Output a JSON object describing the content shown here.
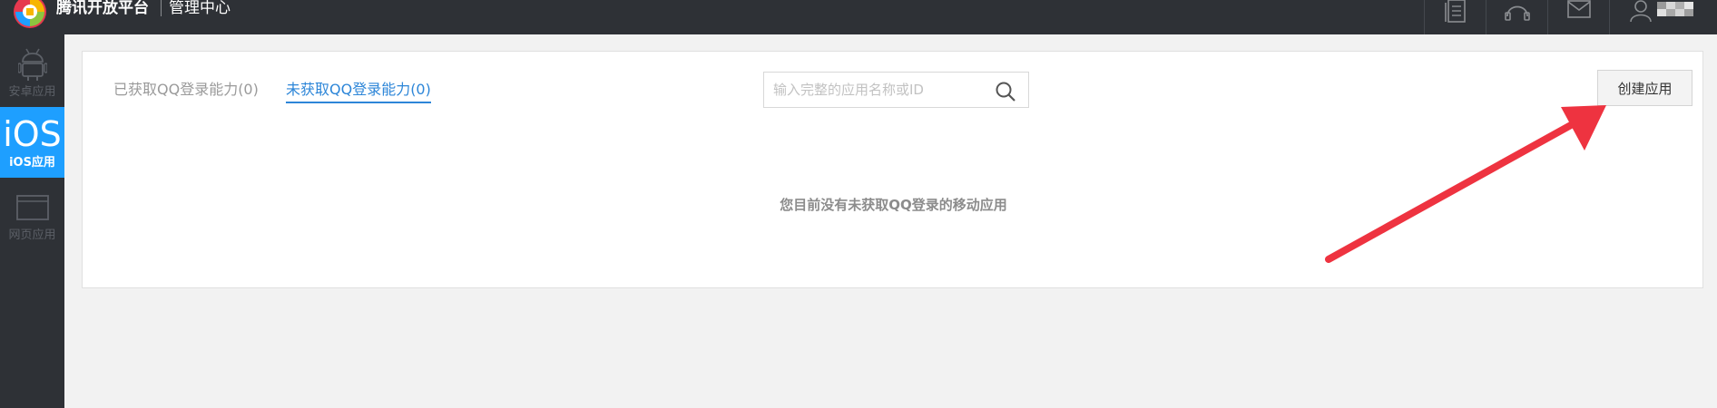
{
  "header": {
    "brand": "腾讯开放平台",
    "center": "管理中心",
    "icons": [
      "document-icon",
      "headset-icon",
      "mail-icon",
      "user-icon"
    ]
  },
  "sidebar": {
    "items": [
      {
        "label": "安卓应用",
        "icon": "android-icon",
        "active": false
      },
      {
        "label": "iOS应用",
        "icon_text": "iOS",
        "active": true
      },
      {
        "label": "网页应用",
        "icon": "browser-window-icon",
        "active": false
      }
    ]
  },
  "main": {
    "tabs": [
      {
        "label": "已获取QQ登录能力(0)",
        "active": false
      },
      {
        "label": "未获取QQ登录能力(0)",
        "active": true
      }
    ],
    "search": {
      "placeholder": "输入完整的应用名称或ID",
      "value": ""
    },
    "create_button": "创建应用",
    "empty_message": "您目前没有未获取QQ登录的移动应用"
  },
  "colors": {
    "topbar": "#2e3136",
    "active_tab": "#2d86d8",
    "sidebar_active": "#1e9fff",
    "annotation_arrow": "#ee3340"
  }
}
